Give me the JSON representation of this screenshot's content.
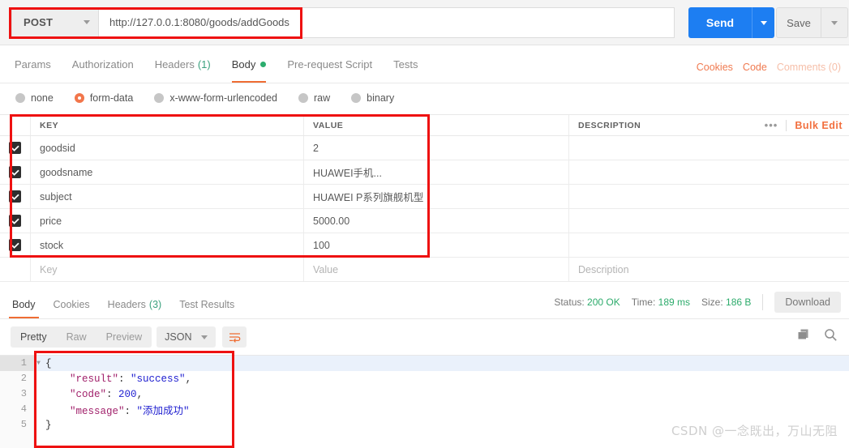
{
  "urlbar": {
    "method": "POST",
    "url": "http://127.0.0.1:8080/goods/addGoods",
    "send_label": "Send",
    "save_label": "Save"
  },
  "request_tabs": [
    {
      "label": "Params",
      "count": "",
      "active": false
    },
    {
      "label": "Authorization",
      "count": "",
      "active": false
    },
    {
      "label": "Headers",
      "count": "(1)",
      "active": false
    },
    {
      "label": "Body",
      "count": "",
      "active": true,
      "dot": true
    },
    {
      "label": "Pre-request Script",
      "count": "",
      "active": false
    },
    {
      "label": "Tests",
      "count": "",
      "active": false
    }
  ],
  "request_tabs_right": {
    "cookies": "Cookies",
    "code": "Code",
    "comments": "Comments (0)"
  },
  "body_types": [
    {
      "label": "none",
      "selected": false
    },
    {
      "label": "form-data",
      "selected": true
    },
    {
      "label": "x-www-form-urlencoded",
      "selected": false
    },
    {
      "label": "raw",
      "selected": false
    },
    {
      "label": "binary",
      "selected": false
    }
  ],
  "kv_table": {
    "headers": {
      "key": "KEY",
      "value": "VALUE",
      "description": "DESCRIPTION"
    },
    "bulk_edit": "Bulk Edit",
    "rows": [
      {
        "checked": true,
        "key": "goodsid",
        "value": "2",
        "description": ""
      },
      {
        "checked": true,
        "key": "goodsname",
        "value": "HUAWEI手机...",
        "description": ""
      },
      {
        "checked": true,
        "key": "subject",
        "value": "HUAWEI P系列旗舰机型",
        "description": ""
      },
      {
        "checked": true,
        "key": "price",
        "value": "5000.00",
        "description": ""
      },
      {
        "checked": true,
        "key": "stock",
        "value": "100",
        "description": ""
      }
    ],
    "placeholder_row": {
      "key": "Key",
      "value": "Value",
      "description": "Description"
    }
  },
  "response_tabs": [
    {
      "label": "Body",
      "count": "",
      "active": true
    },
    {
      "label": "Cookies",
      "count": "",
      "active": false
    },
    {
      "label": "Headers",
      "count": "(3)",
      "active": false
    },
    {
      "label": "Test Results",
      "count": "",
      "active": false
    }
  ],
  "response_meta": {
    "status_label": "Status:",
    "status_value": "200 OK",
    "time_label": "Time:",
    "time_value": "189 ms",
    "size_label": "Size:",
    "size_value": "186 B",
    "download_label": "Download"
  },
  "pretty_bar": {
    "segments": [
      {
        "label": "Pretty",
        "active": true
      },
      {
        "label": "Raw",
        "active": false
      },
      {
        "label": "Preview",
        "active": false
      }
    ],
    "format": "JSON"
  },
  "response_body": {
    "lines": [
      {
        "num": "1",
        "fold": true,
        "highlight": true,
        "tokens": [
          {
            "t": "punc",
            "v": "{"
          }
        ]
      },
      {
        "num": "2",
        "fold": false,
        "highlight": false,
        "tokens": [
          {
            "t": "plain",
            "v": "    "
          },
          {
            "t": "key",
            "v": "\"result\""
          },
          {
            "t": "punc",
            "v": ": "
          },
          {
            "t": "str",
            "v": "\"success\""
          },
          {
            "t": "punc",
            "v": ","
          }
        ]
      },
      {
        "num": "3",
        "fold": false,
        "highlight": false,
        "tokens": [
          {
            "t": "plain",
            "v": "    "
          },
          {
            "t": "key",
            "v": "\"code\""
          },
          {
            "t": "punc",
            "v": ": "
          },
          {
            "t": "num",
            "v": "200"
          },
          {
            "t": "punc",
            "v": ","
          }
        ]
      },
      {
        "num": "4",
        "fold": false,
        "highlight": false,
        "tokens": [
          {
            "t": "plain",
            "v": "    "
          },
          {
            "t": "key",
            "v": "\"message\""
          },
          {
            "t": "punc",
            "v": ": "
          },
          {
            "t": "str",
            "v": "\"添加成功\""
          }
        ]
      },
      {
        "num": "5",
        "fold": false,
        "highlight": false,
        "tokens": [
          {
            "t": "punc",
            "v": "}"
          }
        ]
      }
    ]
  },
  "watermark": "CSDN @一念既出，万山无阻",
  "colors": {
    "accent_orange": "#ef6d33",
    "send_blue": "#1d7ef2",
    "status_green": "#2cab6b",
    "annotation_red": "#ee1111"
  }
}
